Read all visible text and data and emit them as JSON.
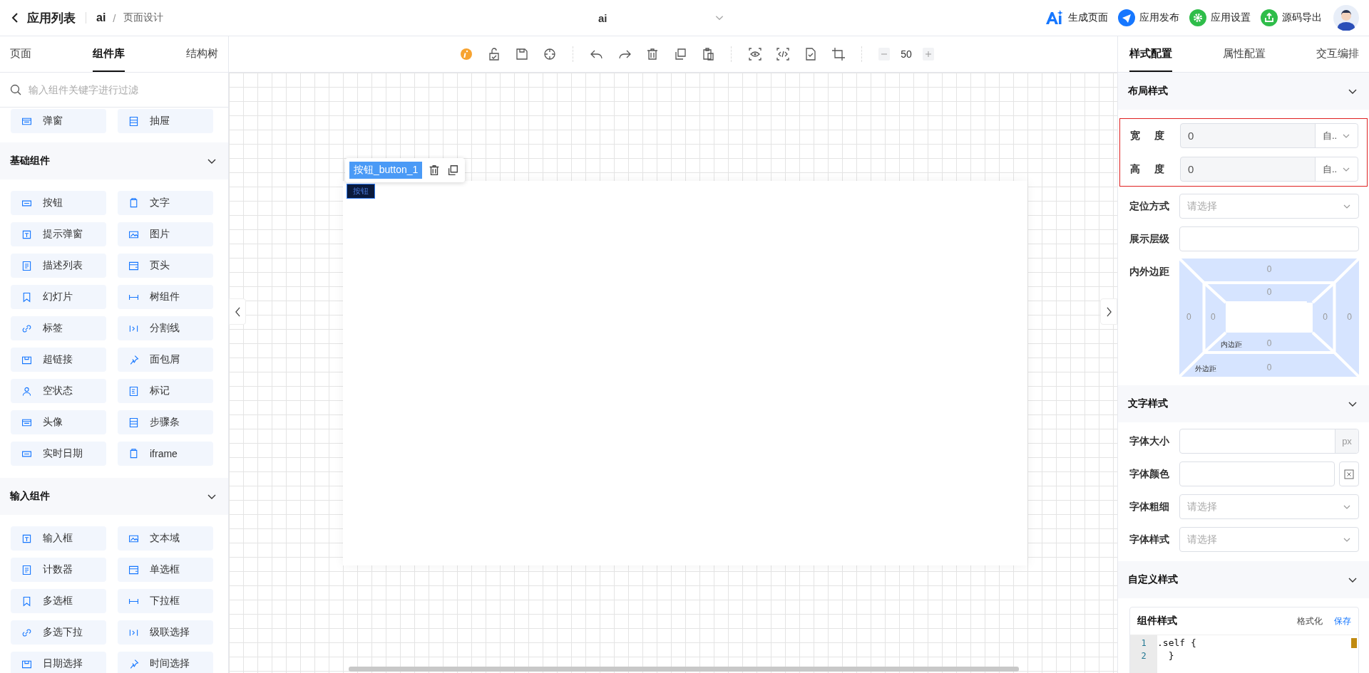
{
  "header": {
    "back_label": "应用列表",
    "app_name": "ai",
    "separator": "/",
    "page_label": "页面设计",
    "center_title": "ai",
    "actions": [
      {
        "kind": "ai",
        "label": "生成页面"
      },
      {
        "kind": "publish",
        "label": "应用发布",
        "color": "#1677ff"
      },
      {
        "kind": "settings",
        "label": "应用设置",
        "color": "#2fbd4a"
      },
      {
        "kind": "export",
        "label": "源码导出",
        "color": "#2fbd4a"
      }
    ]
  },
  "left_tabs": [
    {
      "label": "页面",
      "selected": false
    },
    {
      "label": "组件库",
      "selected": true
    },
    {
      "label": "结构树",
      "selected": false
    }
  ],
  "search": {
    "placeholder": "输入组件关键字进行过滤"
  },
  "groups": [
    {
      "items": [
        "弹窗",
        "抽屉"
      ]
    },
    {
      "title": "基础组件",
      "expanded": true,
      "items": [
        "按钮",
        "文字",
        "提示弹窗",
        "图片",
        "描述列表",
        "页头",
        "幻灯片",
        "树组件",
        "标签",
        "分割线",
        "超链接",
        "面包屑",
        "空状态",
        "标记",
        "头像",
        "步骤条",
        "实时日期",
        "iframe"
      ]
    },
    {
      "title": "输入组件",
      "expanded": true,
      "items": [
        "输入框",
        "文本域",
        "计数器",
        "单选框",
        "多选框",
        "下拉框",
        "多选下拉",
        "级联选择",
        "日期选择",
        "时间选择"
      ]
    }
  ],
  "toolbar": {
    "zoom": "50"
  },
  "canvas": {
    "selection_label": "按钮_button_1",
    "button_text": "按钮"
  },
  "right_tabs": [
    {
      "label": "样式配置",
      "selected": true
    },
    {
      "label": "属性配置",
      "selected": false
    },
    {
      "label": "交互编排",
      "selected": false
    }
  ],
  "sections": [
    {
      "title": "布局样式",
      "expanded": true,
      "fields": [
        {
          "kind": "unit-select",
          "label": "宽 度",
          "value": "0",
          "unit": "自..",
          "highlighted": true
        },
        {
          "kind": "unit-select",
          "label": "高 度",
          "value": "0",
          "unit": "自..",
          "highlighted": true
        },
        {
          "kind": "select",
          "label": "定位方式",
          "placeholder": "请选择"
        },
        {
          "kind": "input",
          "label": "展示层级"
        },
        {
          "kind": "spacing",
          "label": "内外边距",
          "outer": [
            "0",
            "0",
            "0",
            "0"
          ],
          "inner": [
            "0",
            "0",
            "0",
            "0"
          ],
          "inner_label": "内边距",
          "outer_label": "外边距"
        }
      ]
    },
    {
      "title": "文字样式",
      "expanded": true,
      "fields": [
        {
          "kind": "unit-input",
          "label": "字体大小",
          "unit": "px"
        },
        {
          "kind": "color",
          "label": "字体颜色"
        },
        {
          "kind": "select",
          "label": "字体粗细",
          "placeholder": "请选择"
        },
        {
          "kind": "select",
          "label": "字体样式",
          "placeholder": "请选择"
        }
      ]
    },
    {
      "title": "自定义样式",
      "expanded": true,
      "editor": {
        "title": "组件样式",
        "format_label": "格式化",
        "save_label": "保存",
        "lines": [
          {
            "number": "1",
            "code": ".self {"
          },
          {
            "number": "2",
            "code": "  }"
          }
        ]
      }
    }
  ]
}
